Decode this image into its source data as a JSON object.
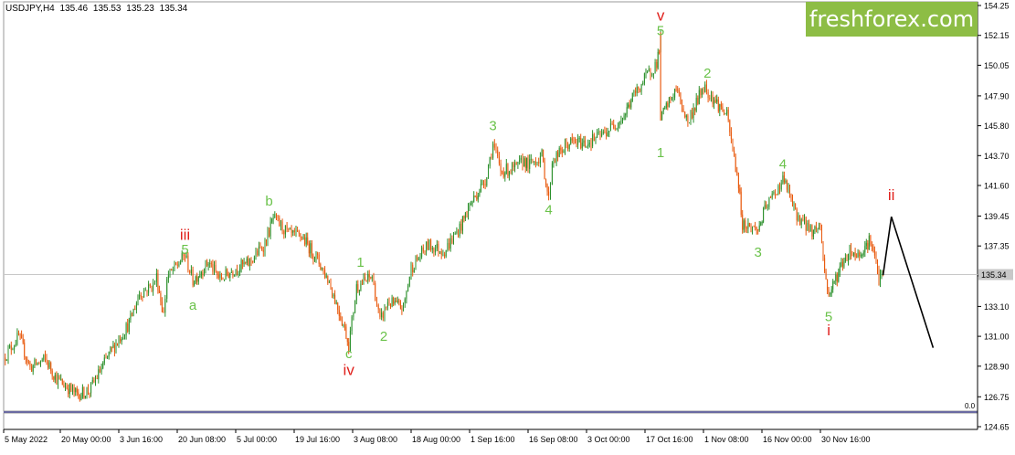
{
  "header": {
    "symbol_timeframe": "USDJPY,H4",
    "ohlc": [
      "135.46",
      "135.53",
      "135.23",
      "135.34"
    ]
  },
  "watermark": {
    "text": "freshforex.com",
    "color": "#8dbd45"
  },
  "colors": {
    "bull": "#2a8f2a",
    "bear": "#e8570a",
    "wave_green": "#6ac24a",
    "wave_red": "#e0201c",
    "forecast": "#000000"
  },
  "chart_data": {
    "type": "candlestick",
    "title": "USDJPY,H4",
    "ylim": [
      124.65,
      154.25
    ],
    "yticks": [
      "154.25",
      "152.15",
      "150.05",
      "147.90",
      "145.80",
      "143.70",
      "141.60",
      "139.45",
      "137.35",
      "135.25",
      "133.10",
      "131.00",
      "128.90",
      "126.75",
      "124.65"
    ],
    "xticks": [
      "5 May 2022",
      "20 May 00:00",
      "3 Jun 16:00",
      "20 Jun 08:00",
      "5 Jul 00:00",
      "19 Jul 16:00",
      "3 Aug 08:00",
      "18 Aug 00:00",
      "1 Sep 16:00",
      "16 Sep 08:00",
      "3 Oct 00:00",
      "17 Oct 16:00",
      "1 Nov 08:00",
      "16 Nov 00:00",
      "30 Nov 16:00"
    ],
    "current_price": "135.34",
    "indicator_zero_label": "0.0",
    "price_path": [
      {
        "date": "5 May",
        "price": 129.5
      },
      {
        "date": "9 May",
        "price": 131.0
      },
      {
        "date": "12 May",
        "price": 128.8
      },
      {
        "date": "16 May",
        "price": 129.4
      },
      {
        "date": "19 May",
        "price": 128.0
      },
      {
        "date": "24 May",
        "price": 126.9
      },
      {
        "date": "27 May",
        "price": 127.2
      },
      {
        "date": "1 Jun",
        "price": 129.9
      },
      {
        "date": "3 Jun",
        "price": 130.8
      },
      {
        "date": "6 Jun",
        "price": 131.9
      },
      {
        "date": "9 Jun",
        "price": 134.0
      },
      {
        "date": "13 Jun",
        "price": 134.6
      },
      {
        "date": "14 Jun",
        "price": 135.2
      },
      {
        "date": "16 Jun",
        "price": 132.5
      },
      {
        "date": "17 Jun",
        "price": 135.1
      },
      {
        "date": "22 Jun",
        "price": 136.7
      },
      {
        "date": "24 Jun",
        "price": 134.9
      },
      {
        "date": "28 Jun",
        "price": 136.2
      },
      {
        "date": "1 Jul",
        "price": 135.0
      },
      {
        "date": "5 Jul",
        "price": 135.8
      },
      {
        "date": "8 Jul",
        "price": 136.1
      },
      {
        "date": "12 Jul",
        "price": 137.5
      },
      {
        "date": "14 Jul",
        "price": 139.3
      },
      {
        "date": "18 Jul",
        "price": 138.1
      },
      {
        "date": "21 Jul",
        "price": 138.0
      },
      {
        "date": "25 Jul",
        "price": 136.4
      },
      {
        "date": "28 Jul",
        "price": 134.8
      },
      {
        "date": "1 Aug",
        "price": 131.5
      },
      {
        "date": "2 Aug",
        "price": 130.4
      },
      {
        "date": "4 Aug",
        "price": 134.5
      },
      {
        "date": "8 Aug",
        "price": 135.2
      },
      {
        "date": "10 Aug",
        "price": 132.0
      },
      {
        "date": "12 Aug",
        "price": 133.4
      },
      {
        "date": "16 Aug",
        "price": 133.0
      },
      {
        "date": "18 Aug",
        "price": 135.8
      },
      {
        "date": "22 Aug",
        "price": 137.4
      },
      {
        "date": "26 Aug",
        "price": 137.0
      },
      {
        "date": "30 Aug",
        "price": 138.8
      },
      {
        "date": "1 Sep",
        "price": 140.2
      },
      {
        "date": "5 Sep",
        "price": 142.0
      },
      {
        "date": "7 Sep",
        "price": 144.5
      },
      {
        "date": "9 Sep",
        "price": 142.6
      },
      {
        "date": "13 Sep",
        "price": 142.8
      },
      {
        "date": "15 Sep",
        "price": 143.4
      },
      {
        "date": "16 Sep",
        "price": 143.0
      },
      {
        "date": "20 Sep",
        "price": 143.7
      },
      {
        "date": "22 Sep",
        "price": 140.6
      },
      {
        "date": "23 Sep",
        "price": 143.3
      },
      {
        "date": "28 Sep",
        "price": 144.6
      },
      {
        "date": "3 Oct",
        "price": 144.6
      },
      {
        "date": "7 Oct",
        "price": 145.2
      },
      {
        "date": "12 Oct",
        "price": 146.5
      },
      {
        "date": "14 Oct",
        "price": 147.8
      },
      {
        "date": "18 Oct",
        "price": 149.5
      },
      {
        "date": "20 Oct",
        "price": 150.2
      },
      {
        "date": "21 Oct",
        "price": 151.9
      },
      {
        "date": "21 Oct",
        "price": 146.3
      },
      {
        "date": "25 Oct",
        "price": 148.4
      },
      {
        "date": "28 Oct",
        "price": 146.0
      },
      {
        "date": "1 Nov",
        "price": 148.6
      },
      {
        "date": "3 Nov",
        "price": 147.9
      },
      {
        "date": "7 Nov",
        "price": 146.5
      },
      {
        "date": "10 Nov",
        "price": 141.7
      },
      {
        "date": "11 Nov",
        "price": 138.9
      },
      {
        "date": "15 Nov",
        "price": 138.5
      },
      {
        "date": "17 Nov",
        "price": 140.1
      },
      {
        "date": "21 Nov",
        "price": 142.0
      },
      {
        "date": "22 Nov",
        "price": 141.5
      },
      {
        "date": "24 Nov",
        "price": 139.6
      },
      {
        "date": "28 Nov",
        "price": 138.4
      },
      {
        "date": "30 Nov",
        "price": 138.8
      },
      {
        "date": "1 Dec",
        "price": 135.5
      },
      {
        "date": "2 Dec",
        "price": 133.9
      },
      {
        "date": "5 Dec",
        "price": 136.0
      },
      {
        "date": "7 Dec",
        "price": 137.0
      },
      {
        "date": "9 Dec",
        "price": 136.7
      },
      {
        "date": "12 Dec",
        "price": 137.8
      },
      {
        "date": "14 Dec",
        "price": 135.0
      },
      {
        "date": "15 Dec",
        "price": 135.3
      }
    ],
    "forecast_path": [
      {
        "date": "15 Dec",
        "price": 135.3
      },
      {
        "date": "17 Dec",
        "price": 139.4
      },
      {
        "date": "27 Dec",
        "price": 130.2
      }
    ],
    "wave_labels": [
      {
        "text": "iii",
        "date": "22 Jun",
        "price": 138.1,
        "color": "red"
      },
      {
        "text": "5",
        "date": "22 Jun",
        "price": 137.1,
        "color": "green"
      },
      {
        "text": "a",
        "date": "24 Jun",
        "price": 133.2,
        "color": "green"
      },
      {
        "text": "b",
        "date": "13 Jul",
        "price": 140.5,
        "color": "green"
      },
      {
        "text": "c",
        "date": "2 Aug",
        "price": 129.8,
        "color": "green"
      },
      {
        "text": "iv",
        "date": "2 Aug",
        "price": 128.6,
        "color": "red"
      },
      {
        "text": "1",
        "date": "5 Aug",
        "price": 136.2,
        "color": "green"
      },
      {
        "text": "2",
        "date": "11 Aug",
        "price": 131.0,
        "color": "green"
      },
      {
        "text": "3",
        "date": "7 Sep",
        "price": 145.8,
        "color": "green"
      },
      {
        "text": "4",
        "date": "22 Sep",
        "price": 139.9,
        "color": "green"
      },
      {
        "text": "v",
        "date": "21 Oct",
        "price": 153.5,
        "color": "red"
      },
      {
        "text": "5",
        "date": "21 Oct",
        "price": 152.5,
        "color": "green"
      },
      {
        "text": "1",
        "date": "21 Oct",
        "price": 143.9,
        "color": "green"
      },
      {
        "text": "2",
        "date": "2 Nov",
        "price": 149.5,
        "color": "green"
      },
      {
        "text": "3",
        "date": "15 Nov",
        "price": 136.9,
        "color": "green"
      },
      {
        "text": "4",
        "date": "21 Nov",
        "price": 143.1,
        "color": "green"
      },
      {
        "text": "5",
        "date": "2 Dec",
        "price": 132.4,
        "color": "green"
      },
      {
        "text": "i",
        "date": "2 Dec",
        "price": 131.4,
        "color": "red"
      },
      {
        "text": "ii",
        "date": "17 Dec",
        "price": 140.9,
        "color": "red"
      }
    ]
  }
}
